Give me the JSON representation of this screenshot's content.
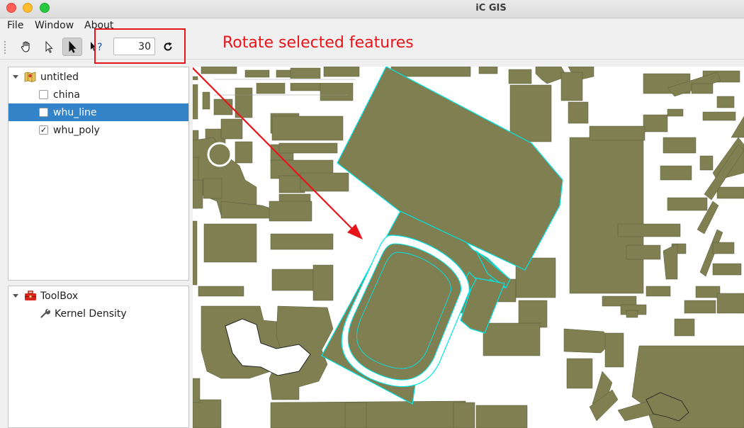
{
  "window": {
    "title": "iC GIS"
  },
  "menu": {
    "items": [
      "File",
      "Window",
      "About"
    ]
  },
  "toolbar": {
    "pan_tool": "hand-icon",
    "select_tool": "arrow-pointer-icon",
    "edit_tool": "filled-arrow-icon",
    "identify_tool": "what-is-this-icon",
    "rotate_angle": "30",
    "rotate_button": "rotate-icon"
  },
  "annotation": {
    "label": "Rotate selected features",
    "color": "#e8141a"
  },
  "layers": {
    "root": "untitled",
    "items": [
      {
        "name": "china",
        "checked": false,
        "selected": false
      },
      {
        "name": "whu_line",
        "checked": false,
        "selected": true
      },
      {
        "name": "whu_poly",
        "checked": true,
        "selected": false
      }
    ]
  },
  "toolbox": {
    "title": "ToolBox",
    "tools": [
      "Kernel Density"
    ]
  },
  "colors": {
    "feature_fill": "#7f7f52",
    "selection_outline": "#00e5e5",
    "selected_row": "#3383c8"
  }
}
